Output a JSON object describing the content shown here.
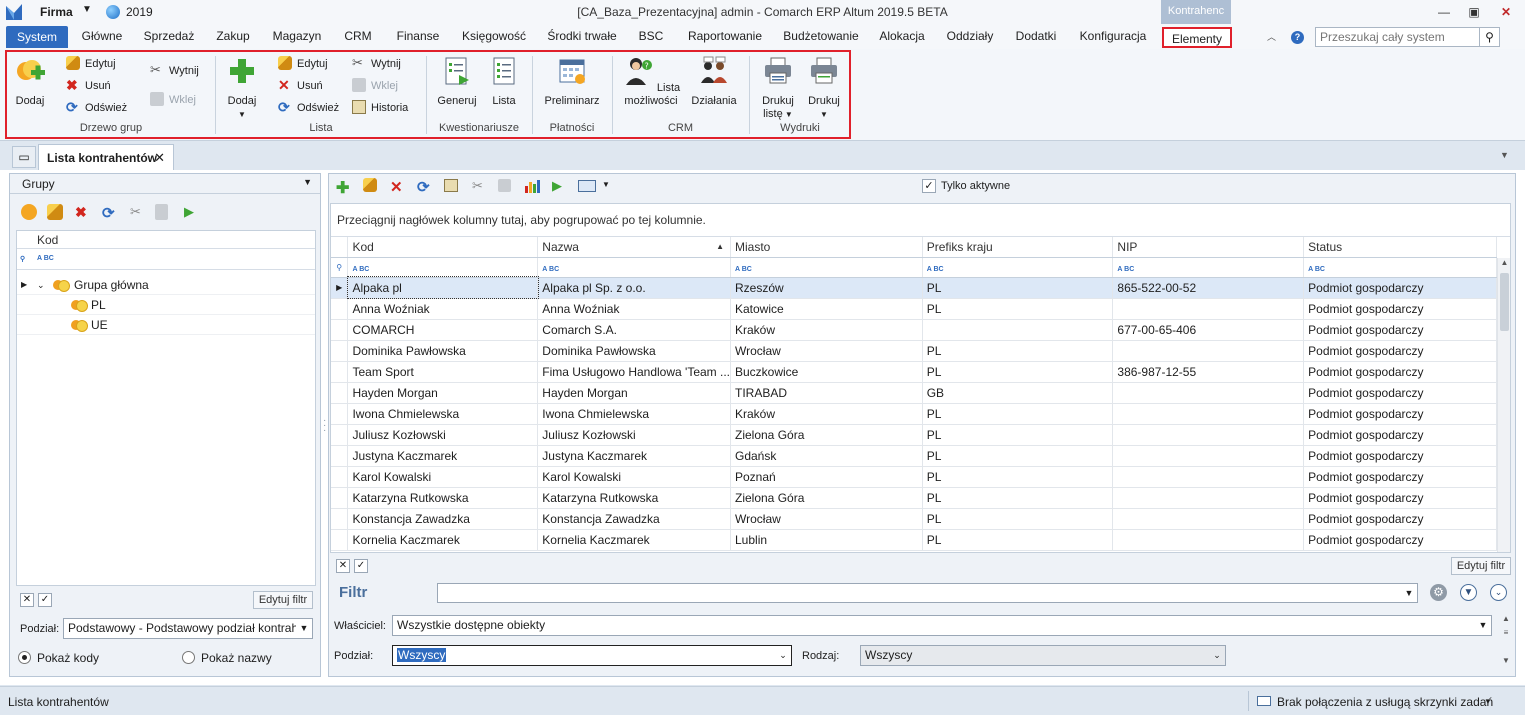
{
  "titlebar": {
    "firma": "Firma",
    "year": "2019",
    "title": "[CA_Baza_Prezentacyjna] admin - Comarch ERP Altum 2019.5 BETA",
    "context_header": "Kontrahenc"
  },
  "tabs": [
    "System",
    "Główne",
    "Sprzedaż",
    "Zakup",
    "Magazyn",
    "CRM",
    "Finanse",
    "Księgowość",
    "Środki trwałe",
    "BSC",
    "Raportowanie",
    "Budżetowanie",
    "Alokacja",
    "Oddziały",
    "Dodatki",
    "Konfiguracja",
    "Elementy"
  ],
  "search": {
    "placeholder": "Przeszukaj cały system"
  },
  "ribbon": {
    "drzewo": {
      "label": "Drzewo grup",
      "dodaj": "Dodaj",
      "edytuj": "Edytuj",
      "usun": "Usuń",
      "odswiez": "Odśwież",
      "wytnij": "Wytnij",
      "wklej": "Wklej"
    },
    "lista": {
      "label": "Lista",
      "dodaj": "Dodaj",
      "edytuj": "Edytuj",
      "usun": "Usuń",
      "odswiez": "Odśwież",
      "wytnij": "Wytnij",
      "wklej": "Wklej",
      "historia": "Historia"
    },
    "kwestionariusze": {
      "label": "Kwestionariusze",
      "generuj": "Generuj",
      "lista": "Lista"
    },
    "platnosci": {
      "label": "Płatności",
      "preliminarz": "Preliminarz"
    },
    "crm": {
      "label": "CRM",
      "lista1": "Lista",
      "lista2": "możliwości",
      "dzialania": "Działania"
    },
    "wydruki": {
      "label": "Wydruki",
      "drukuj_liste1": "Drukuj",
      "drukuj_liste2": "listę",
      "drukuj": "Drukuj"
    }
  },
  "doc_tab": "Lista kontrahentów",
  "left": {
    "header": "Grupy",
    "col_kod": "Kod",
    "tree": [
      {
        "label": "Grupa główna",
        "level": 0
      },
      {
        "label": "PL",
        "level": 1
      },
      {
        "label": "UE",
        "level": 1
      }
    ],
    "edit_filter": "Edytuj filtr",
    "podzial_label": "Podział:",
    "podzial_value": "Podstawowy - Podstawowy podział kontrahe",
    "radio1": "Pokaż kody",
    "radio2": "Pokaż nazwy"
  },
  "right": {
    "tylko_aktywne": "Tylko aktywne",
    "group_hint": "Przeciągnij nagłówek kolumny tutaj, aby pogrupować po tej kolumnie.",
    "columns": [
      "Kod",
      "Nazwa",
      "Miasto",
      "Prefiks kraju",
      "NIP",
      "Status"
    ],
    "rows": [
      [
        "Alpaka pl",
        "Alpaka pl Sp. z o.o.",
        "Rzeszów",
        "PL",
        "865-522-00-52",
        "Podmiot gospodarczy"
      ],
      [
        "Anna Woźniak",
        "Anna Woźniak",
        "Katowice",
        "PL",
        "",
        "Podmiot gospodarczy"
      ],
      [
        "COMARCH",
        "Comarch S.A.",
        "Kraków",
        "",
        "677-00-65-406",
        "Podmiot gospodarczy"
      ],
      [
        "Dominika Pawłowska",
        "Dominika Pawłowska",
        "Wrocław",
        "PL",
        "",
        "Podmiot gospodarczy"
      ],
      [
        "Team Sport",
        "Fima Usługowo Handlowa 'Team ...",
        "Buczkowice",
        "PL",
        "386-987-12-55",
        "Podmiot gospodarczy"
      ],
      [
        "Hayden Morgan",
        "Hayden Morgan",
        "TIRABAD",
        "GB",
        "",
        "Podmiot gospodarczy"
      ],
      [
        "Iwona Chmielewska",
        "Iwona Chmielewska",
        "Kraków",
        "PL",
        "",
        "Podmiot gospodarczy"
      ],
      [
        "Juliusz Kozłowski",
        "Juliusz Kozłowski",
        "Zielona Góra",
        "PL",
        "",
        "Podmiot gospodarczy"
      ],
      [
        "Justyna Kaczmarek",
        "Justyna Kaczmarek",
        "Gdańsk",
        "PL",
        "",
        "Podmiot gospodarczy"
      ],
      [
        "Karol Kowalski",
        "Karol Kowalski",
        "Poznań",
        "PL",
        "",
        "Podmiot gospodarczy"
      ],
      [
        "Katarzyna Rutkowska",
        "Katarzyna Rutkowska",
        "Zielona Góra",
        "PL",
        "",
        "Podmiot gospodarczy"
      ],
      [
        "Konstancja Zawadzka",
        "Konstancja Zawadzka",
        "Wrocław",
        "PL",
        "",
        "Podmiot gospodarczy"
      ],
      [
        "Kornelia Kaczmarek",
        "Kornelia Kaczmarek",
        "Lublin",
        "PL",
        "",
        "Podmiot gospodarczy"
      ]
    ],
    "edit_filter": "Edytuj filtr",
    "filtr_label": "Filtr",
    "wlasciciel_label": "Właściciel:",
    "wlasciciel_value": "Wszystkie dostępne obiekty",
    "podzial_label": "Podział:",
    "podzial_value": "Wszyscy",
    "rodzaj_label": "Rodzaj:",
    "rodzaj_value": "Wszyscy"
  },
  "status": {
    "left": "Lista kontrahentów",
    "right": "Brak połączenia z usługą skrzynki zadań"
  }
}
